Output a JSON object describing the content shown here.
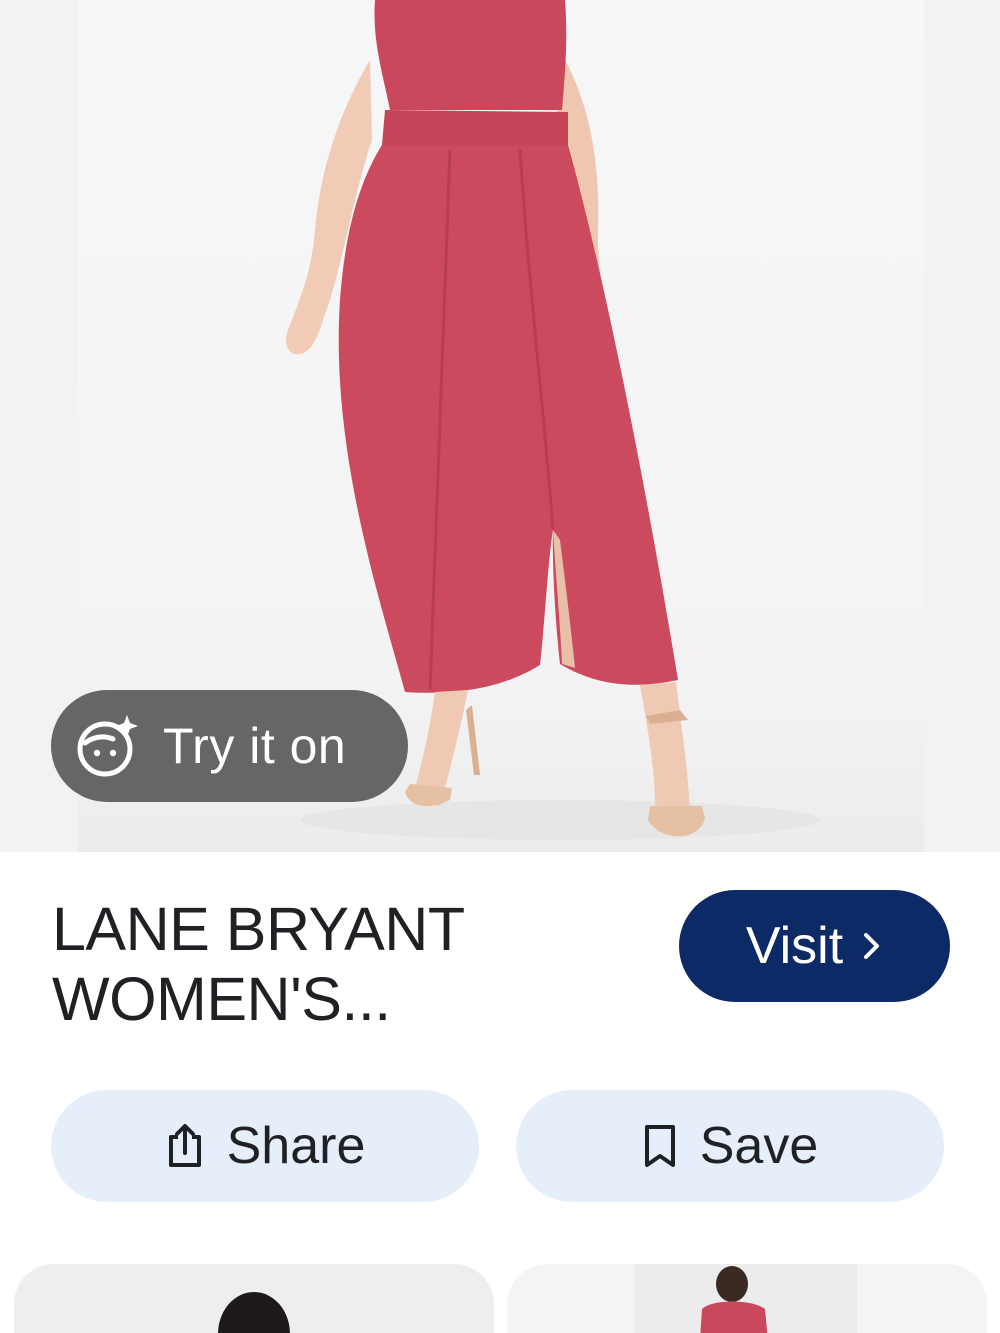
{
  "product": {
    "image_alt": "Woman wearing a red maxi dress with a front slit and nude heeled sandals",
    "title_line1": "LANE BRYANT",
    "title_line2": "WOMEN'S...",
    "dress_color": "#cc4a5e"
  },
  "actions": {
    "try_on_label": "Try it on",
    "try_on_icon": "face-sparkle-icon",
    "visit_label": "Visit",
    "visit_icon": "chevron-right-icon",
    "share_label": "Share",
    "share_icon": "share-icon",
    "save_label": "Save",
    "save_icon": "bookmark-icon"
  },
  "colors": {
    "visit_bg": "#0b2a66",
    "pill_bg": "#e6eefa",
    "try_on_bg": "#5a5a5a"
  },
  "related": {
    "items": [
      {
        "name": "related-product-1"
      },
      {
        "name": "related-product-2"
      }
    ]
  }
}
